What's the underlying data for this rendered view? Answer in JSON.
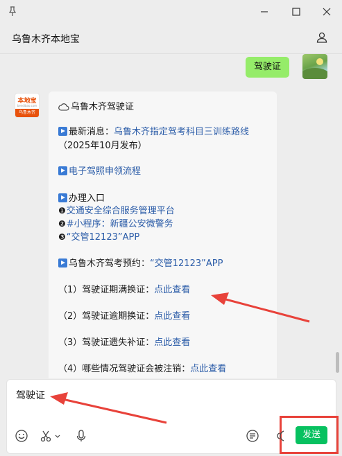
{
  "window": {
    "pin_icon": "pin-icon",
    "controls": [
      "minimize-icon",
      "maximize-icon",
      "close-icon"
    ]
  },
  "header": {
    "title": "乌鲁木齐本地宝",
    "profile_icon": "person-icon"
  },
  "messages": {
    "outgoing": {
      "text": "驾驶证"
    },
    "incoming_avatar": {
      "logo": "本地宝",
      "url": "bendibao.com",
      "badge": "乌鲁木齐"
    },
    "card": {
      "title": "乌鲁木齐驾驶证",
      "news_label": "最新消息：",
      "news_link": "乌鲁木齐指定驾考科目三训练路线",
      "news_date": "（2025年10月发布）",
      "ecert_link": "电子驾照申领流程",
      "entry_label": "办理入口",
      "entry_items": [
        {
          "bullet": "❶",
          "link": "交通安全综合服务管理平台"
        },
        {
          "bullet": "❷",
          "link": "#小程序：新疆公安微警务"
        },
        {
          "bullet": "❸",
          "link": "“交管12123”APP"
        }
      ],
      "booking_label": "乌鲁木齐驾考预约：",
      "booking_link": "“交管12123”APP",
      "services": [
        {
          "label": "（1）驾驶证期满换证：",
          "link": "点此查看"
        },
        {
          "label": "（2）驾驶证逾期换证：",
          "link": "点此查看"
        },
        {
          "label": "（3）驾驶证遗失补证：",
          "link": "点此查看"
        },
        {
          "label": "（4）哪些情况驾驶证会被注销：",
          "link": "点此查看"
        }
      ]
    }
  },
  "input": {
    "value": "驾驶证",
    "tools": [
      "emoji-icon",
      "scissors-icon",
      "microphone-icon",
      "history-icon",
      "voice-icon"
    ],
    "send_label": "发送"
  },
  "colors": {
    "accent_green": "#07c160",
    "bubble_green": "#95ec69",
    "link_blue": "#2b5ca8",
    "annotation_red": "#e8423a"
  }
}
